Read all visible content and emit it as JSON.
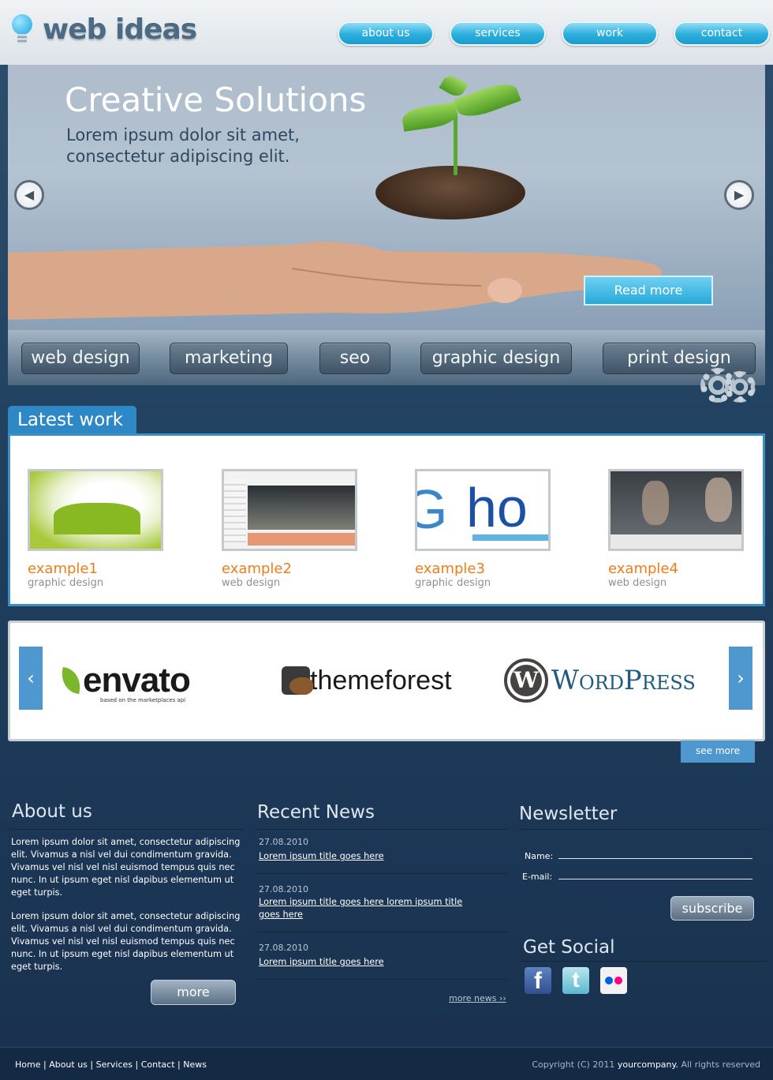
{
  "header": {
    "logo_text": "web ideas",
    "nav": [
      "about us",
      "services",
      "work",
      "contact"
    ]
  },
  "hero": {
    "title": "Creative Solutions",
    "subtitle_line1": "Lorem ipsum dolor sit amet,",
    "subtitle_line2": "consectetur adipiscing elit.",
    "read_more": "Read more",
    "prev_arrow": "◀",
    "next_arrow": "▶"
  },
  "categories": [
    "web design",
    "marketing",
    "seo",
    "graphic design",
    "print design"
  ],
  "latest_work": {
    "tab": "Latest work",
    "items": [
      {
        "title": "example1",
        "category": "graphic design"
      },
      {
        "title": "example2",
        "category": "web design"
      },
      {
        "title": "example3",
        "category": "graphic design"
      },
      {
        "title": "example4",
        "category": "web design"
      }
    ]
  },
  "partners": {
    "prev": "‹",
    "next": "›",
    "envato": "envato",
    "envato_sub": "based on the marketplaces api",
    "themeforest": "themeforest",
    "wordpress": "WordPress",
    "see_more": "see more"
  },
  "about": {
    "title": "About us",
    "para1": "Lorem ipsum dolor sit amet, consectetur adipiscing elit. Vivamus a nisl vel dui condimentum gravida. Vivamus vel nisl vel nisl euismod tempus quis nec nunc. In ut ipsum eget nisl dapibus elementum ut eget turpis.",
    "para2": "Lorem ipsum dolor sit amet, consectetur adipiscing elit. Vivamus a nisl vel dui condimentum gravida. Vivamus vel nisl vel nisl euismod tempus quis nec nunc. In ut ipsum eget nisl dapibus elementum ut eget turpis.",
    "more": "more"
  },
  "news": {
    "title": "Recent News",
    "items": [
      {
        "date": "27.08.2010",
        "title": "Lorem ipsum title goes here"
      },
      {
        "date": "27.08.2010",
        "title": "Lorem ipsum title goes here lorem ipsum title goes here"
      },
      {
        "date": "27.08.2010",
        "title": "Lorem ipsum title goes here"
      }
    ],
    "more": "more news ››"
  },
  "newsletter": {
    "title": "Newsletter",
    "name_label": "Name:",
    "email_label": "E-mail:",
    "subscribe": "subscribe"
  },
  "social": {
    "title": "Get Social",
    "facebook_glyph": "f",
    "twitter_glyph": "t"
  },
  "footer": {
    "links": [
      "Home",
      "About us",
      "Services",
      "Contact",
      "News"
    ],
    "copyright_prefix": "Copyright (C) 2011",
    "company": "yourcompany.",
    "rights": "All rights reserved"
  }
}
